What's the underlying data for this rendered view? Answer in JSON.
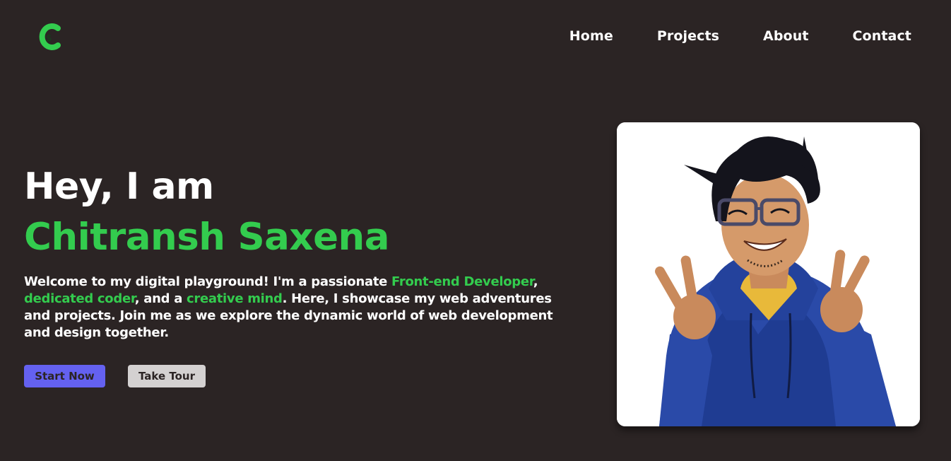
{
  "header": {
    "logo_icon": "c-dollar-logo-icon",
    "nav": [
      {
        "label": "Home"
      },
      {
        "label": "Projects"
      },
      {
        "label": "About"
      },
      {
        "label": "Contact"
      }
    ]
  },
  "hero": {
    "greeting": "Hey, I am",
    "name": "Chitransh Saxena",
    "intro": {
      "part1": "Welcome to my digital playground! I'm a passionate ",
      "highlight1": "Front-end Developer",
      "part2": ", ",
      "highlight2": "dedicated coder",
      "part3": ", and a ",
      "highlight3": "creative mind",
      "part4": ". Here, I showcase my web adventures and projects. Join me as we explore the dynamic world of web development and design together."
    },
    "buttons": {
      "start": "Start Now",
      "tour": "Take Tour"
    }
  },
  "portrait": {
    "image": "cartoon-portrait-peace-sign-blue-hoodie"
  },
  "colors": {
    "background": "#2b2424",
    "accent_green": "#33cc4e",
    "button_primary": "#6461f0",
    "button_secondary": "#d4d1d1",
    "hoodie_blue": "#2a4aa8"
  }
}
